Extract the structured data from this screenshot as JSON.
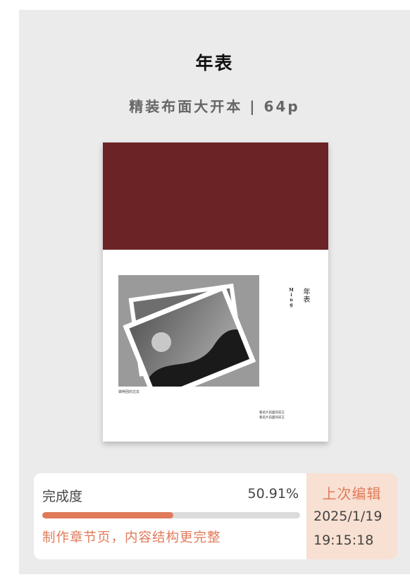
{
  "product": {
    "title": "年表",
    "subtitle": "精装布面大开本 | 64p"
  },
  "cover": {
    "band_color": "#6b2326",
    "title": "年表",
    "latin": "Ming",
    "caption": "做种团的过去",
    "bottom_line_1": "看名片前面的前言",
    "bottom_line_2": "看名片前面的前言",
    "photo_icon": "image-placeholder-icon"
  },
  "progress": {
    "label": "完成度",
    "percent_text": "50.91%",
    "value": 50.91,
    "hint": "制作章节页，内容结构更完整",
    "accent_color": "#e07a5a"
  },
  "last_edit": {
    "label": "上次编辑",
    "date": "2025/1/19",
    "time": "19:15:18",
    "background_color": "#f8e0d2"
  }
}
